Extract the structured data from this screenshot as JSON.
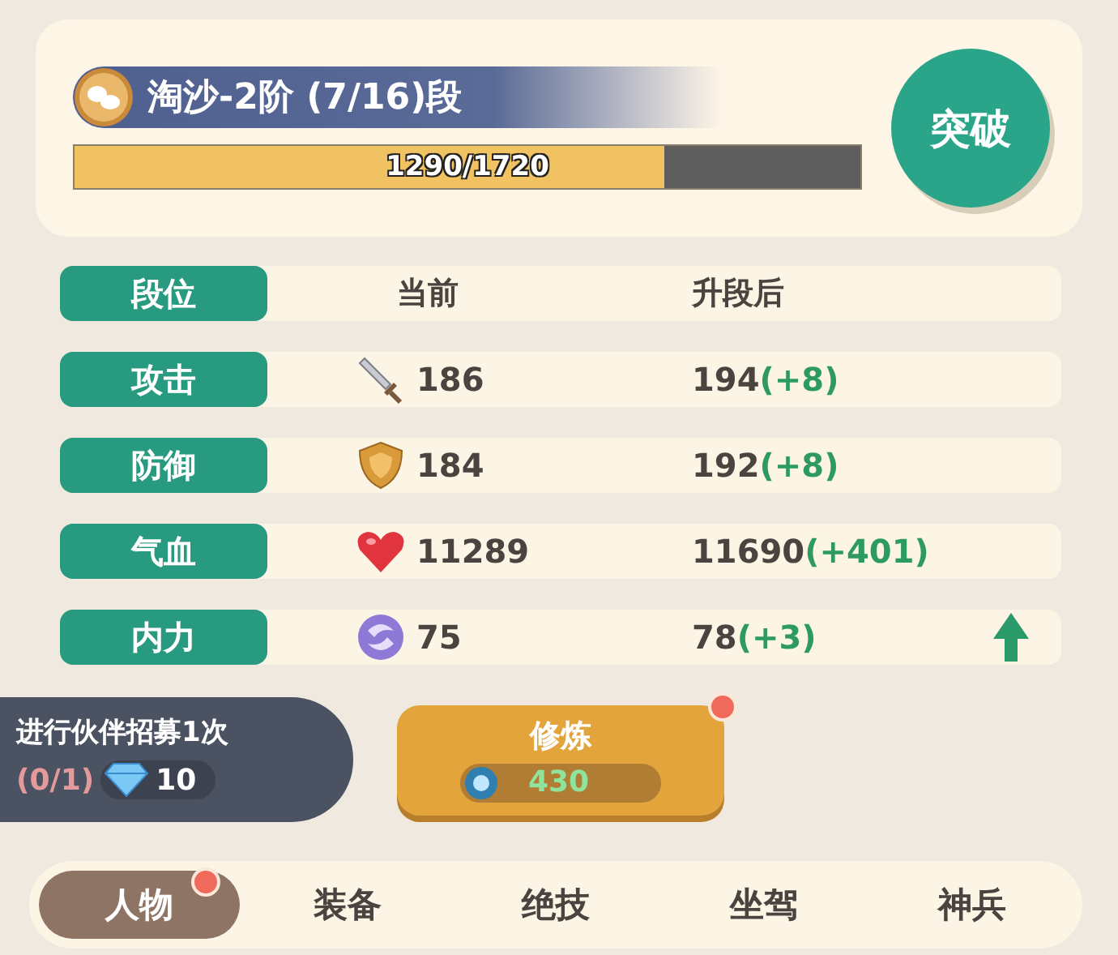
{
  "header": {
    "title": "淘沙-2阶 (7/16)段",
    "progress": {
      "level": 0.75,
      "reading": "1290/1720"
    },
    "breakthrough_button": "突破"
  },
  "stats": {
    "columns": [
      "段位",
      "当前",
      "升段后"
    ],
    "rows": [
      {
        "name": "攻击",
        "kind": "attack",
        "current": "186",
        "next": "194",
        "gain": "(+8)",
        "improvable": false
      },
      {
        "name": "防御",
        "kind": "defense",
        "current": "184",
        "next": "192",
        "gain": "(+8)",
        "improvable": false
      },
      {
        "name": "气血",
        "kind": "health",
        "current": "11289",
        "next": "11690",
        "gain": "(+401)",
        "improvable": false
      },
      {
        "name": "内力",
        "kind": "energy",
        "current": "75",
        "next": "78",
        "gain": "(+3)",
        "improvable": true
      }
    ]
  },
  "task": {
    "text": "进行伙伴招募1次",
    "progress": "(0/1)",
    "cost": "10"
  },
  "train_button": {
    "label": "修炼",
    "cost": "430",
    "alert": true
  },
  "tabs": [
    {
      "label": "人物",
      "selected": true,
      "alert": true
    },
    {
      "label": "装备",
      "selected": false,
      "alert": false
    },
    {
      "label": "绝技",
      "selected": false,
      "alert": false
    },
    {
      "label": "坐驾",
      "selected": false,
      "alert": false
    },
    {
      "label": "神兵",
      "selected": false,
      "alert": false
    }
  ]
}
